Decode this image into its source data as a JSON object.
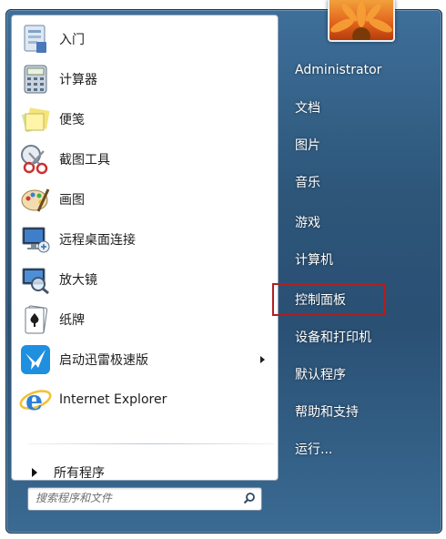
{
  "programs": [
    {
      "label": "入门",
      "icon": "getting-started-icon"
    },
    {
      "label": "计算器",
      "icon": "calculator-icon"
    },
    {
      "label": "便笺",
      "icon": "sticky-notes-icon"
    },
    {
      "label": "截图工具",
      "icon": "snipping-tool-icon"
    },
    {
      "label": "画图",
      "icon": "paint-icon"
    },
    {
      "label": "远程桌面连接",
      "icon": "remote-desktop-icon"
    },
    {
      "label": "放大镜",
      "icon": "magnifier-icon"
    },
    {
      "label": "纸牌",
      "icon": "solitaire-icon"
    },
    {
      "label": "启动迅雷极速版",
      "icon": "thunder-icon"
    },
    {
      "label": "Internet Explorer",
      "icon": "internet-explorer-icon"
    }
  ],
  "all_programs": {
    "label": "所有程序"
  },
  "search": {
    "placeholder": "搜索程序和文件"
  },
  "user": {
    "name": "Administrator"
  },
  "right_links": [
    {
      "label": "文档"
    },
    {
      "label": "图片"
    },
    {
      "label": "音乐"
    },
    {
      "label": "游戏"
    },
    {
      "label": "计算机"
    },
    {
      "label": "控制面板"
    },
    {
      "label": "设备和打印机"
    },
    {
      "label": "默认程序"
    },
    {
      "label": "帮助和支持"
    },
    {
      "label": "运行..."
    }
  ],
  "colors": {
    "highlight": "#b51d1d",
    "menu_glass": "#2d5679"
  }
}
